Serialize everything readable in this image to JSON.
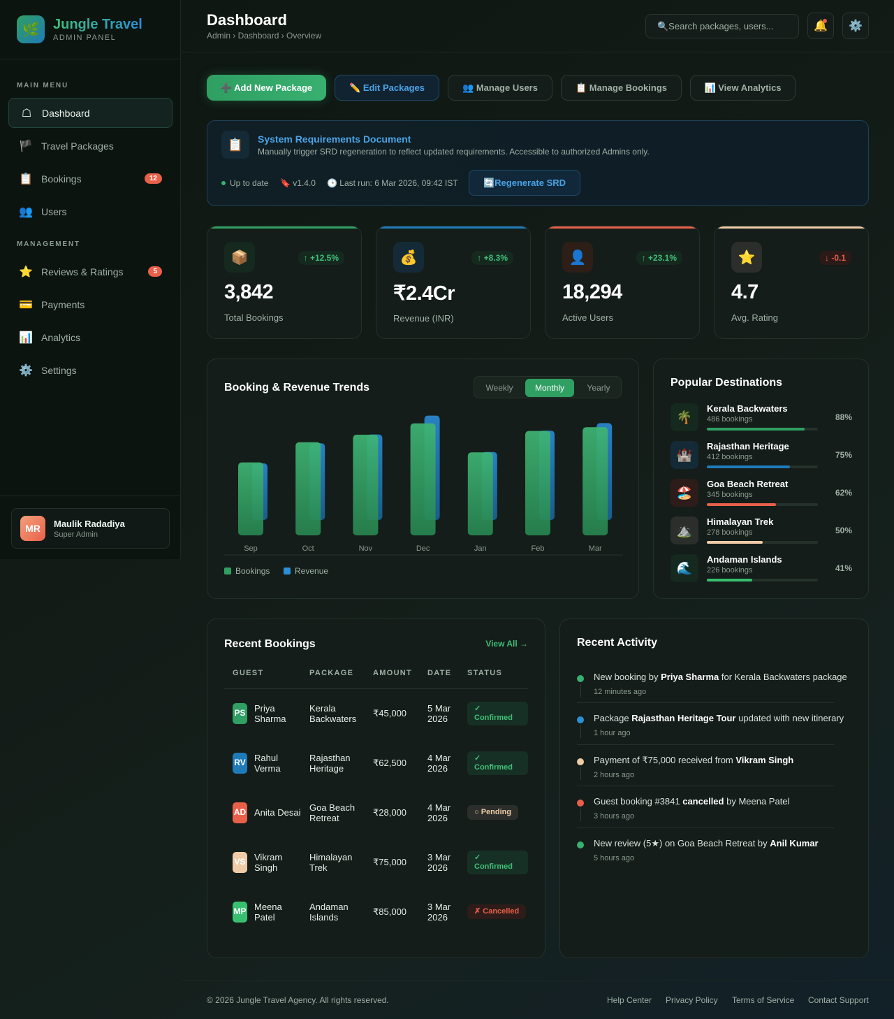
{
  "brand": {
    "title": "Jungle Travel",
    "subtitle": "ADMIN PANEL",
    "logo": "🌿"
  },
  "sidebar": {
    "main_menu_label": "MAIN MENU",
    "management_label": "MANAGEMENT",
    "items": [
      {
        "label": "Dashboard",
        "icon": "☖",
        "active": true
      },
      {
        "label": "Travel Packages",
        "icon": "🏴"
      },
      {
        "label": "Bookings",
        "icon": "📋",
        "badge": "12"
      },
      {
        "label": "Users",
        "icon": "👥"
      },
      {
        "label": "Reviews & Ratings",
        "icon": "⭐",
        "badge": "5"
      },
      {
        "label": "Payments",
        "icon": "💳"
      },
      {
        "label": "Analytics",
        "icon": "📊"
      },
      {
        "label": "Settings",
        "icon": "⚙️"
      }
    ]
  },
  "user": {
    "initials": "MR",
    "name": "Maulik Radadiya",
    "role": "Super Admin"
  },
  "header": {
    "title": "Dashboard",
    "breadcrumb": "Admin › Dashboard › Overview",
    "search_placeholder": "🔍Search packages, users...",
    "bell": "🔔",
    "gear": "⚙️"
  },
  "quick_actions": [
    {
      "label": "➕ Add New Package"
    },
    {
      "label": "✏️ Edit Packages"
    },
    {
      "label": "👥 Manage Users"
    },
    {
      "label": "📋 Manage Bookings"
    },
    {
      "label": "📊 View Analytics"
    }
  ],
  "srd": {
    "icon": "📋",
    "title": "System Requirements Document",
    "description": "Manually trigger SRD regeneration to reflect updated requirements. Accessible to authorized Admins only.",
    "status": "Up to date",
    "version": "🔖 v1.4.0",
    "last_run": "🕒 Last run: 6 Mar 2026, 09:42 IST",
    "button": "🔄Regenerate SRD"
  },
  "stats": [
    {
      "icon": "📦",
      "trend": "↑ +12.5%",
      "value": "3,842",
      "label": "Total Bookings",
      "color": "#2f9f62"
    },
    {
      "icon": "💰",
      "trend": "↑ +8.3%",
      "value": "₹2.4Cr",
      "label": "Revenue (INR)",
      "color": "#1f7ab8"
    },
    {
      "icon": "👤",
      "trend": "↑ +23.1%",
      "value": "18,294",
      "label": "Active Users",
      "color": "#e8604a"
    },
    {
      "icon": "⭐",
      "trend": "↓ -0.1",
      "value": "4.7",
      "label": "Avg. Rating",
      "color": "#f0cba8"
    }
  ],
  "trends": {
    "title": "Booking & Revenue Trends",
    "tabs": [
      "Weekly",
      "Monthly",
      "Yearly"
    ],
    "active_tab": "Monthly",
    "legend": [
      "Bookings",
      "Revenue"
    ]
  },
  "chart_data": {
    "type": "bar",
    "categories": [
      "Sep",
      "Oct",
      "Nov",
      "Dec",
      "Jan",
      "Feb",
      "Mar"
    ],
    "series": [
      {
        "name": "Bookings",
        "values": [
          58,
          74,
          80,
          89,
          66,
          83,
          86
        ],
        "color": "#2f9f62"
      },
      {
        "name": "Revenue",
        "values": [
          45,
          61,
          68,
          83,
          54,
          71,
          77
        ],
        "color": "#1f7ab8"
      }
    ],
    "ylim": [
      0,
      100
    ]
  },
  "destinations": {
    "title": "Popular Destinations",
    "items": [
      {
        "icon": "🌴",
        "name": "Kerala Backwaters",
        "count": "486 bookings",
        "pct": "88%",
        "value": 88,
        "color": "#2f9f62",
        "bg": "#15291f"
      },
      {
        "icon": "🏰",
        "name": "Rajasthan Heritage",
        "count": "412 bookings",
        "pct": "75%",
        "value": 75,
        "color": "#1f7ab8",
        "bg": "#142a36"
      },
      {
        "icon": "🏖️",
        "name": "Goa Beach Retreat",
        "count": "345 bookings",
        "pct": "62%",
        "value": 62,
        "color": "#e8604a",
        "bg": "#2d1c19"
      },
      {
        "icon": "⛰️",
        "name": "Himalayan Trek",
        "count": "278 bookings",
        "pct": "50%",
        "value": 50,
        "color": "#f0cba8",
        "bg": "#2b2e2a"
      },
      {
        "icon": "🌊",
        "name": "Andaman Islands",
        "count": "226 bookings",
        "pct": "41%",
        "value": 41,
        "color": "#38c070",
        "bg": "#15291f"
      }
    ]
  },
  "bookings": {
    "title": "Recent Bookings",
    "view_all": "View All →",
    "columns": [
      "GUEST",
      "PACKAGE",
      "AMOUNT",
      "DATE",
      "STATUS"
    ],
    "rows": [
      {
        "initials": "PS",
        "guest": "Priya Sharma",
        "package": "Kerala Backwaters",
        "amount": "₹45,000",
        "date": "5 Mar 2026",
        "status": "✓ Confirmed",
        "kind": "confirmed",
        "color": "#2f9f62"
      },
      {
        "initials": "RV",
        "guest": "Rahul Verma",
        "package": "Rajasthan Heritage",
        "amount": "₹62,500",
        "date": "4 Mar 2026",
        "status": "✓ Confirmed",
        "kind": "confirmed",
        "color": "#1f7ab8"
      },
      {
        "initials": "AD",
        "guest": "Anita Desai",
        "package": "Goa Beach Retreat",
        "amount": "₹28,000",
        "date": "4 Mar 2026",
        "status": "○ Pending",
        "kind": "pending",
        "color": "#e8604a"
      },
      {
        "initials": "VS",
        "guest": "Vikram Singh",
        "package": "Himalayan Trek",
        "amount": "₹75,000",
        "date": "3 Mar 2026",
        "status": "✓ Confirmed",
        "kind": "confirmed",
        "color": "#f0cba8"
      },
      {
        "initials": "MP",
        "guest": "Meena Patel",
        "package": "Andaman Islands",
        "amount": "₹85,000",
        "date": "3 Mar 2026",
        "status": "✗ Cancelled",
        "kind": "cancelled",
        "color": "#38c070"
      }
    ]
  },
  "activity": {
    "title": "Recent Activity",
    "items": [
      {
        "pre": "New booking by ",
        "bold": "Priya Sharma",
        "post": " for Kerala Backwaters package",
        "time": "12 minutes ago",
        "color": "#38b070"
      },
      {
        "pre": "Package ",
        "bold": "Rajasthan Heritage Tour",
        "post": " updated with new itinerary",
        "time": "1 hour ago",
        "color": "#2c8fd6"
      },
      {
        "pre": "Payment of ₹75,000 received from ",
        "bold": "Vikram Singh",
        "post": "",
        "time": "2 hours ago",
        "color": "#f0cba8"
      },
      {
        "pre": "Guest booking #3841 ",
        "bold": "cancelled",
        "post": " by Meena Patel",
        "time": "3 hours ago",
        "color": "#e8604a"
      },
      {
        "pre": "New review (5★) on Goa Beach Retreat by ",
        "bold": "Anil Kumar",
        "post": "",
        "time": "5 hours ago",
        "color": "#38b070"
      }
    ]
  },
  "footer": {
    "copyright": "© 2026 Jungle Travel Agency. All rights reserved.",
    "links": [
      "Help Center",
      "Privacy Policy",
      "Terms of Service",
      "Contact Support"
    ]
  }
}
